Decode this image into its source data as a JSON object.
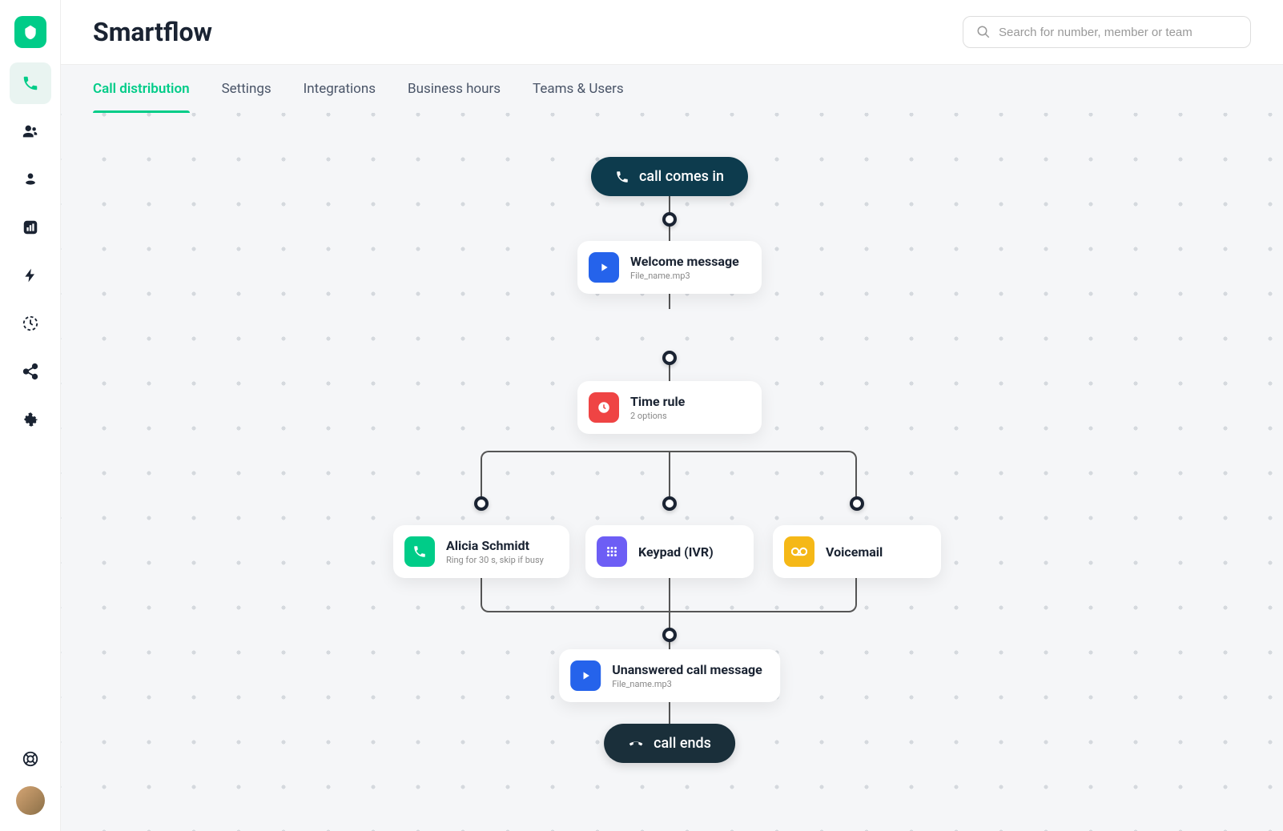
{
  "page": {
    "title": "Smartflow"
  },
  "search": {
    "placeholder": "Search for number, member or team"
  },
  "tabs": [
    {
      "label": "Call distribution",
      "active": true
    },
    {
      "label": "Settings",
      "active": false
    },
    {
      "label": "Integrations",
      "active": false
    },
    {
      "label": "Business hours",
      "active": false
    },
    {
      "label": "Teams & Users",
      "active": false
    }
  ],
  "flow": {
    "start": {
      "label": "call comes in"
    },
    "end": {
      "label": "call ends"
    },
    "welcome": {
      "title": "Welcome message",
      "sub": "File_name.mp3"
    },
    "timerule": {
      "title": "Time rule",
      "sub": "2 options"
    },
    "branch": {
      "agent": {
        "title": "Alicia Schmidt",
        "sub": "Ring for 30 s, skip if busy"
      },
      "ivr": {
        "title": "Keypad (IVR)"
      },
      "voicemail": {
        "title": "Voicemail"
      }
    },
    "unanswered": {
      "title": "Unanswered call message",
      "sub": "File_name.mp3"
    }
  },
  "colors": {
    "accent": "#00cc88",
    "dark": "#0d3b4d"
  }
}
